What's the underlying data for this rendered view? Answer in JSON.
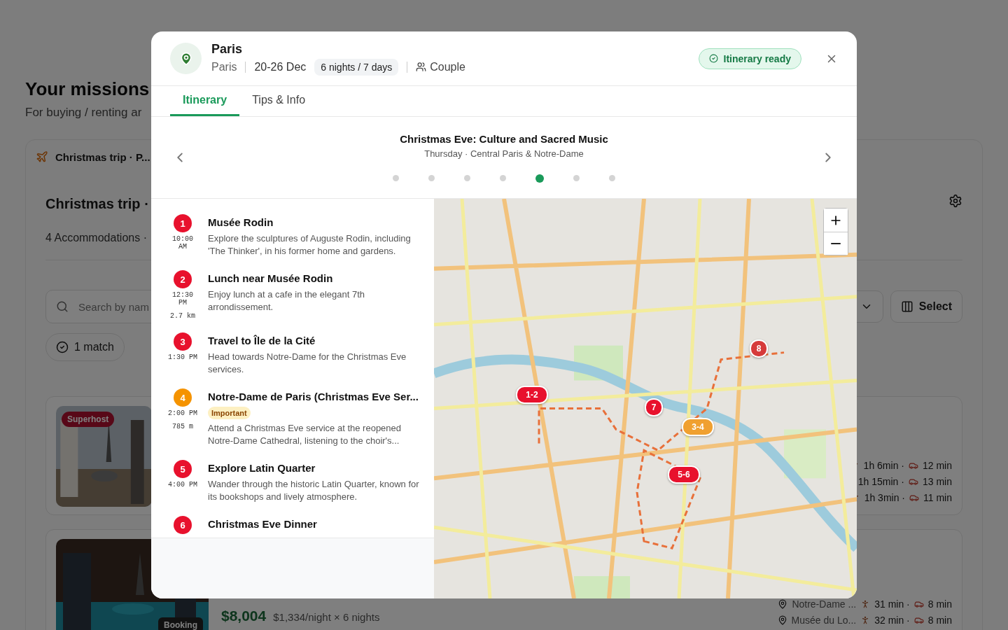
{
  "background": {
    "heading": "Your missions",
    "subheading": "For buying / renting ar",
    "trip_tab": "Christmas trip · P...",
    "trip_title": "Christmas trip ·",
    "accommodations": "4 Accommodations ·",
    "search": {
      "placeholder": "Search by nam"
    },
    "select_button": "Select",
    "match_chip": "1 match",
    "listings": [
      {
        "badge": "Superhost",
        "kind": "superhost",
        "travel": [
          {
            "walk": "1h 6min ·",
            "drive": "12 min"
          },
          {
            "walk": "1h 15min ·",
            "drive": "13 min"
          },
          {
            "walk": "1h 3min ·",
            "drive": "11 min"
          }
        ]
      },
      {
        "badge": "Booking",
        "kind": "booking",
        "price": "$8,004",
        "price_detail": "$1,334/night × 6 nights",
        "travel": [
          {
            "place": "Notre-Dame ...",
            "walk": "31 min ·",
            "drive": "8 min"
          },
          {
            "place": "Musée du Lo...",
            "walk": "32 min ·",
            "drive": "8 min"
          }
        ]
      }
    ]
  },
  "modal": {
    "destination": "Paris",
    "city": "Paris",
    "dates": "20-26 Dec",
    "duration": "6 nights / 7 days",
    "travellers": "Couple",
    "status": "Itinerary ready",
    "tabs": [
      {
        "label": "Itinerary",
        "selected": true
      },
      {
        "label": "Tips & Info",
        "selected": false
      }
    ],
    "day": {
      "title": "Christmas Eve: Culture and Sacred Music",
      "subtitle": "Thursday · Central Paris & Notre-Dame",
      "pages": [
        {
          "selected": false
        },
        {
          "selected": false
        },
        {
          "selected": false
        },
        {
          "selected": false
        },
        {
          "selected": true
        },
        {
          "selected": false
        },
        {
          "selected": false
        }
      ]
    },
    "activities": [
      {
        "number": "1",
        "color": "#e8112d",
        "time": "10:00 AM",
        "title": "Musée Rodin",
        "description": "Explore the sculptures of Auguste Rodin, including 'The Thinker', in his former home and gardens."
      },
      {
        "number": "2",
        "color": "#e8112d",
        "time": "12:30 PM",
        "distance": "2.7 km",
        "title": "Lunch near Musée Rodin",
        "description": "Enjoy lunch at a cafe in the elegant 7th arrondissement."
      },
      {
        "number": "3",
        "color": "#e8112d",
        "time": "1:30 PM",
        "title": "Travel to Île de la Cité",
        "description": "Head towards Notre-Dame for the Christmas Eve services."
      },
      {
        "number": "4",
        "color": "#f59300",
        "time": "2:00 PM",
        "distance": "785 m",
        "title": "Notre-Dame de Paris (Christmas Eve Ser...",
        "tag": "Important",
        "description": "Attend a Christmas Eve service at the reopened Notre-Dame Cathedral, listening to the choir's..."
      },
      {
        "number": "5",
        "color": "#e8112d",
        "time": "4:00 PM",
        "title": "Explore Latin Quarter",
        "description": "Wander through the historic Latin Quarter, known for its bookshops and lively atmosphere."
      },
      {
        "number": "6",
        "color": "#e8112d",
        "title": "Christmas Eve Dinner"
      }
    ],
    "map": {
      "kind": "picture",
      "markers": [
        {
          "label": "1-2",
          "color": "#e8112d"
        },
        {
          "label": "7",
          "color": "#e8112d"
        },
        {
          "label": "3-4",
          "color": "#f0a030"
        },
        {
          "label": "5-6",
          "color": "#e8112d"
        },
        {
          "label": "8",
          "color": "#d63a3a"
        }
      ]
    }
  }
}
